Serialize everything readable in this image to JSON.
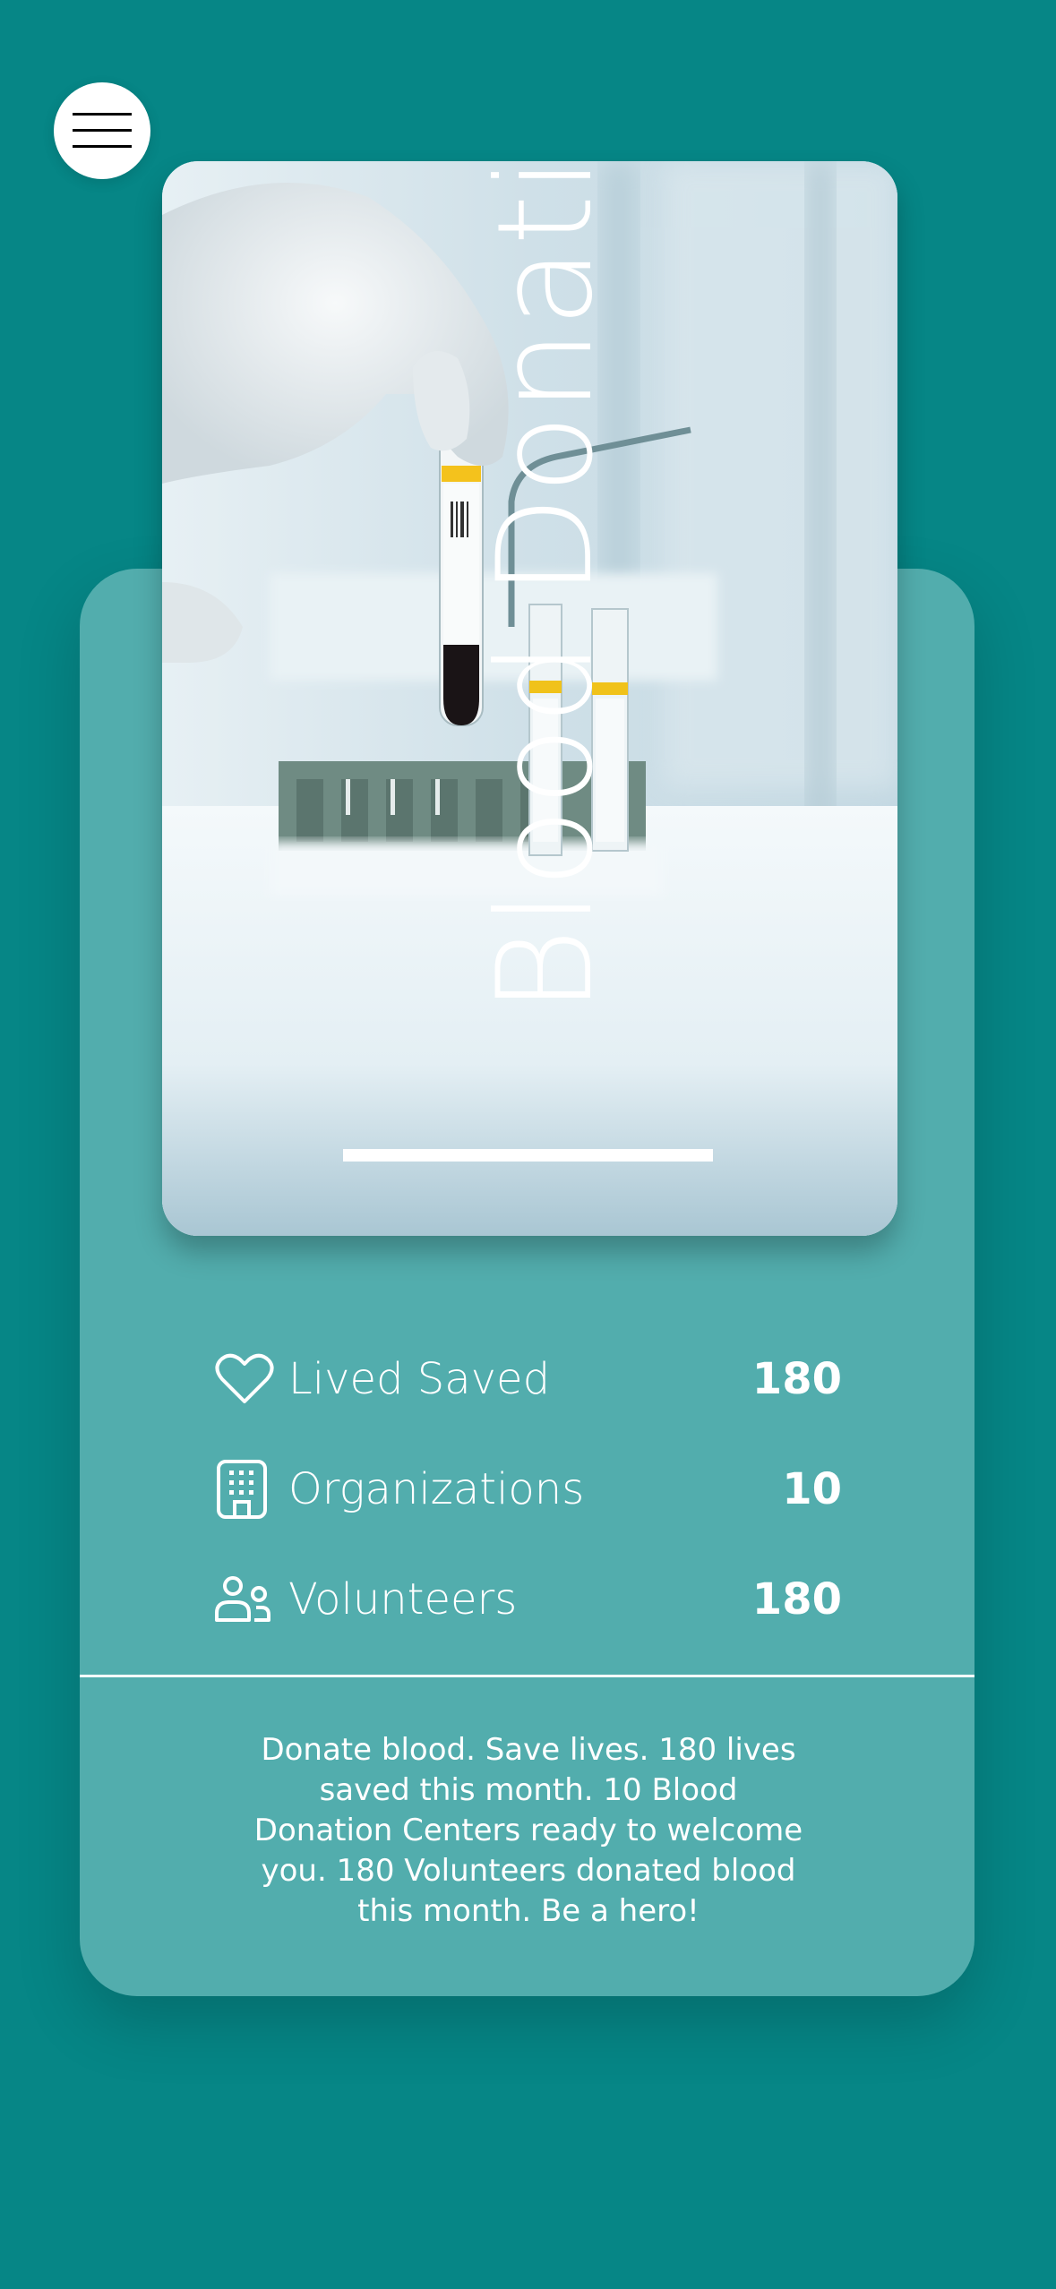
{
  "menu": {
    "icon": "hamburger-menu-icon"
  },
  "hero": {
    "title": "Blood Donation",
    "image": "blood-sample-test-tubes-photo"
  },
  "stats": [
    {
      "icon": "heart-icon",
      "label": "Lived Saved",
      "value": "180"
    },
    {
      "icon": "building-icon",
      "label": "Organizations",
      "value": "10"
    },
    {
      "icon": "users-icon",
      "label": "Volunteers",
      "value": "180"
    }
  ],
  "message": "Donate blood. Save lives. 180 lives\nsaved this month. 10 Blood\nDonation Centers ready to welcome\nyou.  180  Volunteers donated blood\nthis month. Be a hero!",
  "colors": {
    "background": "#068686",
    "card": "#52adad",
    "text": "#ffffff"
  }
}
